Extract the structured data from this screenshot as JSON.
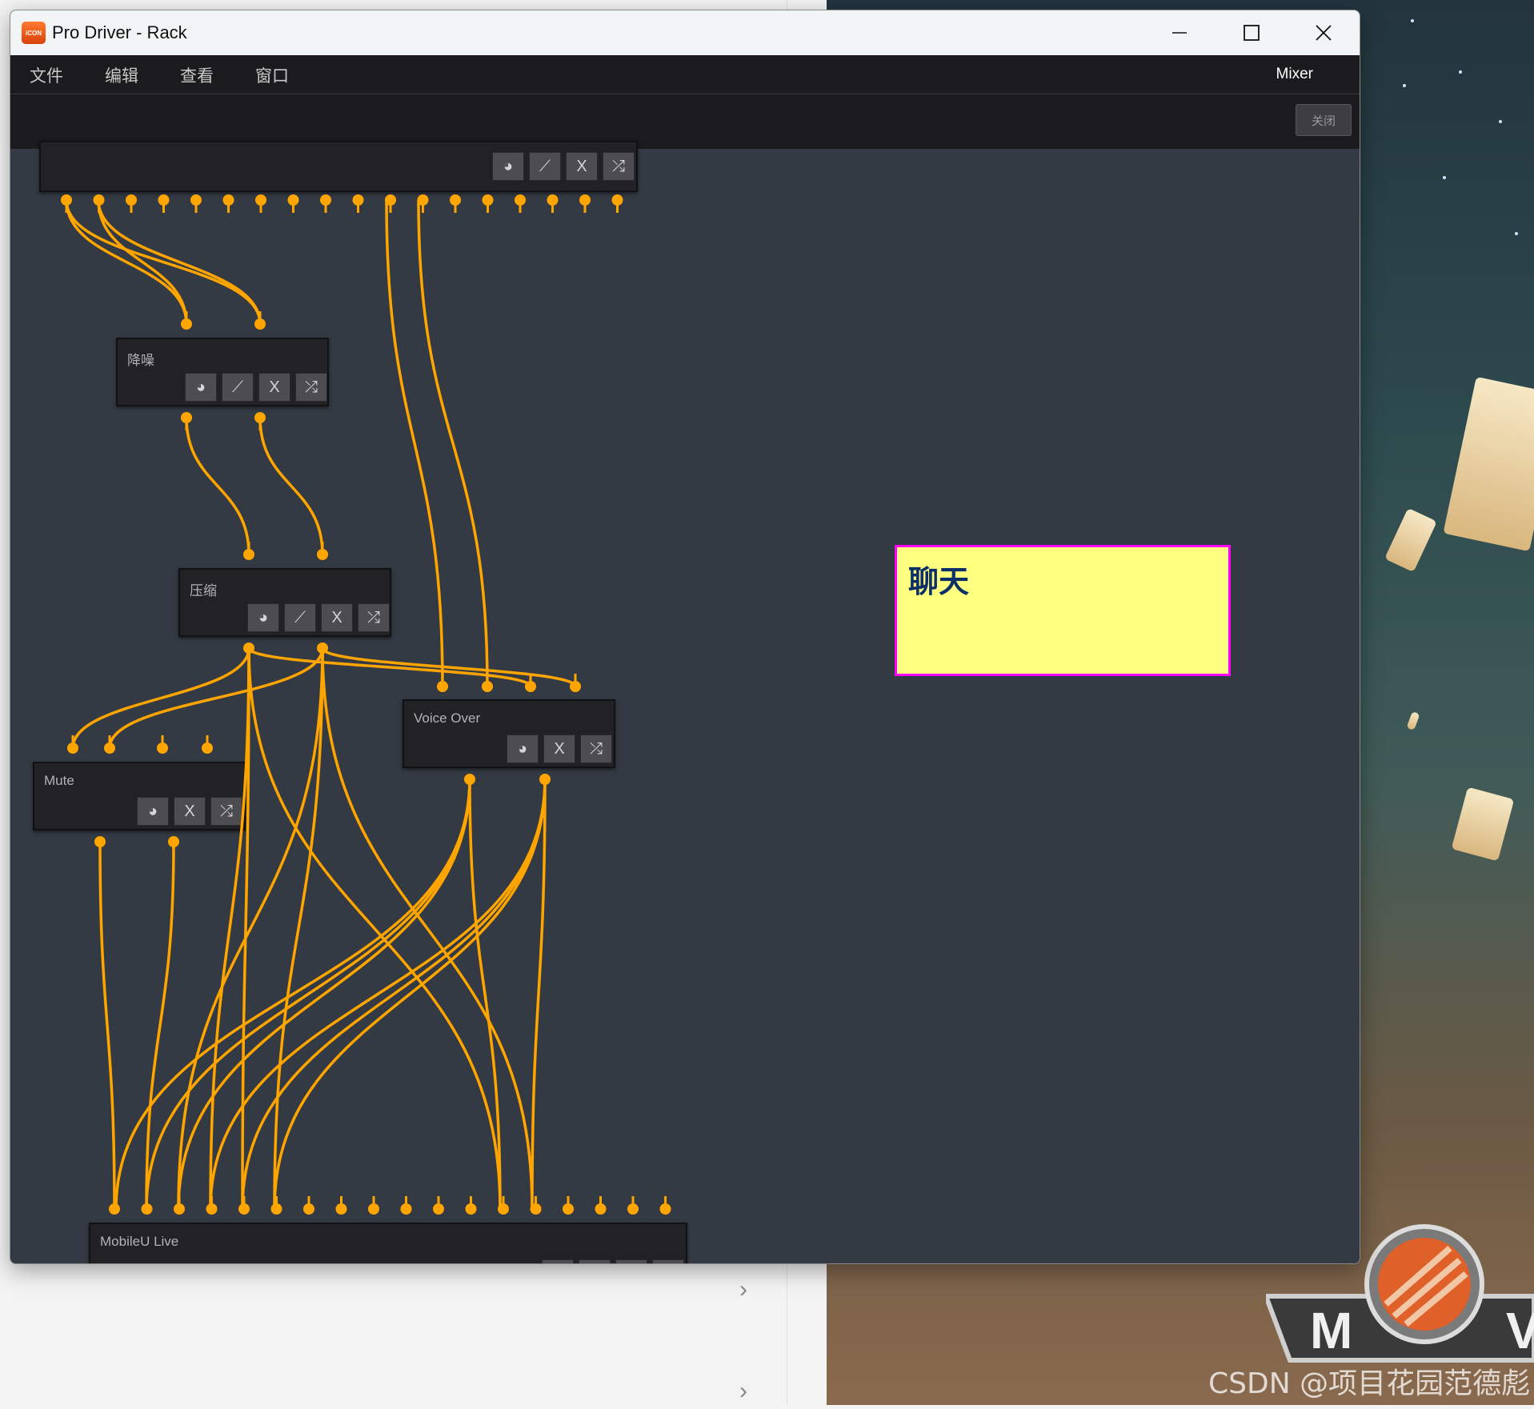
{
  "window": {
    "title": "Pro Driver - Rack",
    "icon_text": "iCON"
  },
  "menu": {
    "items": [
      "文件",
      "编辑",
      "查看",
      "窗口"
    ],
    "mixer": "Mixer"
  },
  "toolbar": {
    "close_label": "关闭"
  },
  "modules": {
    "top": {
      "label": ""
    },
    "noise": {
      "label": "降噪"
    },
    "compress": {
      "label": "压缩"
    },
    "voiceover": {
      "label": "Voice Over"
    },
    "mute": {
      "label": "Mute"
    },
    "mobileu": {
      "label": "MobileU Live"
    }
  },
  "note": {
    "title": "聊天"
  },
  "watermark": "CSDN @项目花园范德彪",
  "logo": {
    "letters": [
      "M",
      "V"
    ]
  },
  "colors": {
    "cable": "#ffa500",
    "canvas": "#343a43",
    "note_bg": "#ffff80",
    "note_border": "#ff00ff"
  },
  "icons": {
    "power": "power-knob-icon",
    "pencil": "edit-icon",
    "close": "close-icon",
    "shuffle": "shuffle-icon"
  }
}
